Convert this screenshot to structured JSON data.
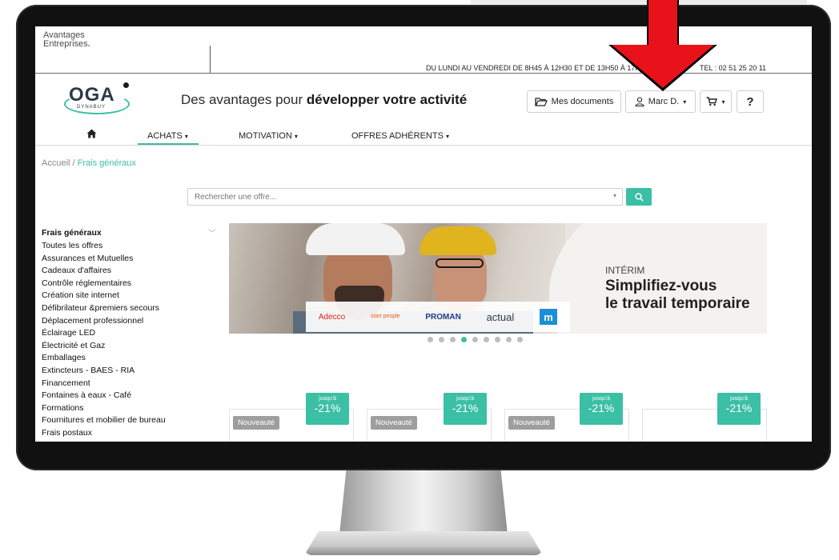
{
  "brand": {
    "line1": "Avantages",
    "line2": "Entreprises",
    "dot": "."
  },
  "topbar": {
    "hours": "DU LUNDI AU VENDREDI DE 8H45 À 12H30 ET DE 13H50 À 17H",
    "phone": "TEL : 02 51 25 20 11"
  },
  "logo": {
    "name": "OGA",
    "sub": "DYNABUY"
  },
  "header": {
    "tagline_prefix": "Des avantages pour ",
    "tagline_bold": "développer votre activité",
    "documents_label": "Mes documents",
    "user_label": "Marc D.",
    "help_label": "?"
  },
  "nav": {
    "items": [
      {
        "label": "ACHATS"
      },
      {
        "label": "MOTIVATION"
      },
      {
        "label": "OFFRES ADHÉRENTS"
      }
    ]
  },
  "breadcrumb": {
    "home": "Accueil",
    "sep": " / ",
    "current": "Frais généraux"
  },
  "search": {
    "placeholder": "Rechercher une offre..."
  },
  "sidebar": {
    "title": "Frais généraux",
    "items": [
      "Toutes les offres",
      "Assurances et Mutuelles",
      "Cadeaux d'affaires",
      "Contrôle réglementaires",
      "Création site internet",
      "Défibrilateur &premiers secours",
      "Déplacement professionnel",
      "Éclairage LED",
      "Électricité et Gaz",
      "Emballages",
      "Extincteurs - BAES - RIA",
      "Financement",
      "Fontaines à eaux - Café",
      "Formations",
      "Fournitures et mobilier de bureau",
      "Frais postaux"
    ]
  },
  "banner": {
    "eyebrow": "INTÉRIM",
    "title_line1": "Simplifiez-vous",
    "title_line2": "le travail temporaire",
    "logos": [
      "Adecco",
      "start people",
      "PROMAN",
      "actual",
      "m"
    ]
  },
  "carousel": {
    "count": 9,
    "active": 3
  },
  "offers": [
    {
      "badge": "Nouveauté",
      "upto": "jusqu'à",
      "discount": "-21%"
    },
    {
      "badge": "Nouveauté",
      "upto": "jusqu'à",
      "discount": "-21%"
    },
    {
      "badge": "Nouveauté",
      "upto": "jusqu'à",
      "discount": "-21%"
    },
    {
      "badge": "",
      "upto": "jusqu'à",
      "discount": "-21%"
    }
  ],
  "colors": {
    "accent": "#3bbfa5",
    "arrow": "#e8121a",
    "text": "#222222"
  }
}
